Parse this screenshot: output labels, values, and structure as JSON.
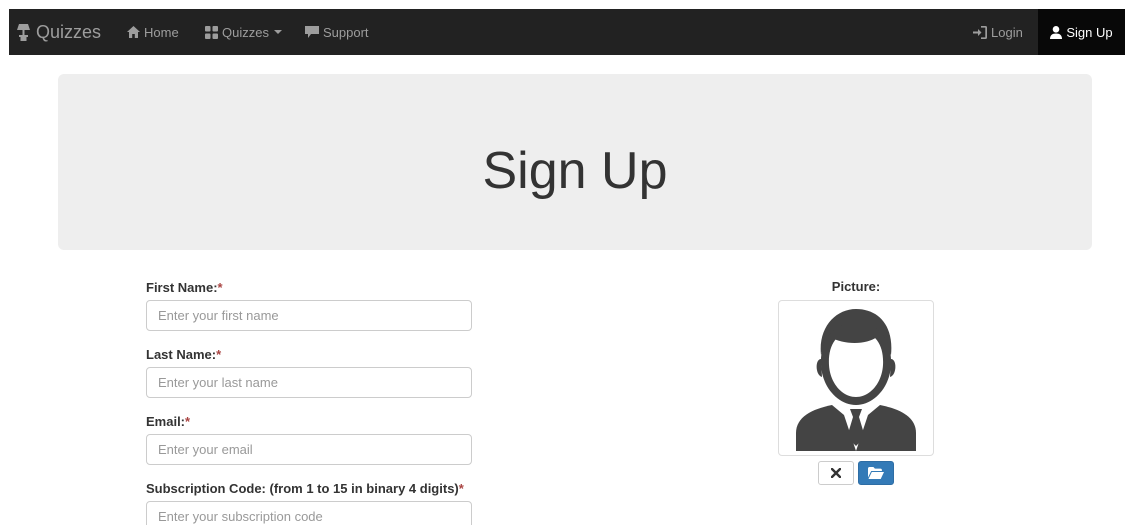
{
  "navbar": {
    "brand": "Quizzes",
    "brand_icon": "lamp-icon",
    "items": [
      {
        "label": "Home",
        "icon": "home-icon"
      },
      {
        "label": "Quizzes",
        "icon": "quizzes-grid-icon"
      },
      {
        "label": "Support",
        "icon": "comment-icon"
      }
    ],
    "right": [
      {
        "label": "Login",
        "icon": "login-icon"
      },
      {
        "label": "Sign Up",
        "icon": "user-icon",
        "active": true
      }
    ],
    "colors": {
      "background": "#222222",
      "text": "#9d9d9d",
      "active_bg": "#080808",
      "active_text": "#ffffff"
    }
  },
  "jumbotron": {
    "title": "Sign Up"
  },
  "form": {
    "required_marker": "*",
    "first_name": {
      "label": "First Name:",
      "placeholder": "Enter your first name",
      "value": ""
    },
    "last_name": {
      "label": "Last Name:",
      "placeholder": "Enter your last name",
      "value": ""
    },
    "email": {
      "label": "Email:",
      "placeholder": "Enter your email",
      "value": ""
    },
    "subscription": {
      "label": "Subscription Code: (from 1 to 15 in binary 4 digits)",
      "placeholder": "Enter your subscription code",
      "value": ""
    }
  },
  "picture": {
    "label": "Picture:",
    "avatar_icon": "default-user-avatar-icon",
    "clear_icon": "close-icon",
    "browse_icon": "folder-open-icon",
    "accent": "#337ab7"
  }
}
